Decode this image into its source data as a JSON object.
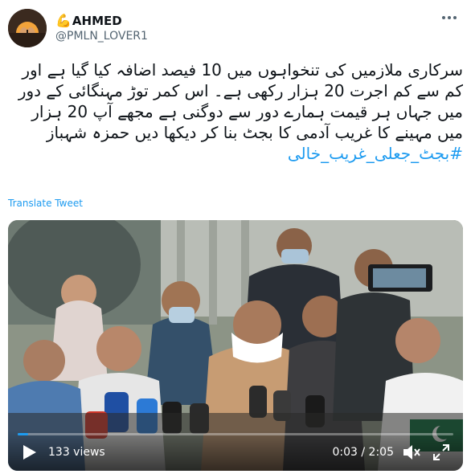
{
  "author": {
    "display_emoji": "💪",
    "display_name": "AHMED",
    "handle": "@PMLN_LOVER1"
  },
  "tweet": {
    "text": "سرکاری ملازمیں کی تنخواہوں میں 10 فیصد اضافہ کیا گیا ہے اور کم سے کم اجرت 20 ہزار رکھی ہے۔ اس کمر توڑ مہنگائی کے دور میں جہاں ہر قیمت ہمارے دور سے دوگنی ہے مجھے آپ 20 ہزار میں مہینے کا غریب آدمی کا بجٹ بنا کر دیکھا دیں حمزہ شہباز",
    "hashtag": "#بجٹ_جعلی_غریب_خالی",
    "translate_label": "Translate Tweet"
  },
  "video": {
    "views": "133 views",
    "time": "0:03 / 2:05",
    "progress": 0.024
  },
  "colors": {
    "accent": "#1d9bf0",
    "text": "#0f1419",
    "secondary": "#536471"
  },
  "icons": [
    "avatar",
    "more-icon",
    "play-icon",
    "mute-icon",
    "fullscreen-icon"
  ]
}
